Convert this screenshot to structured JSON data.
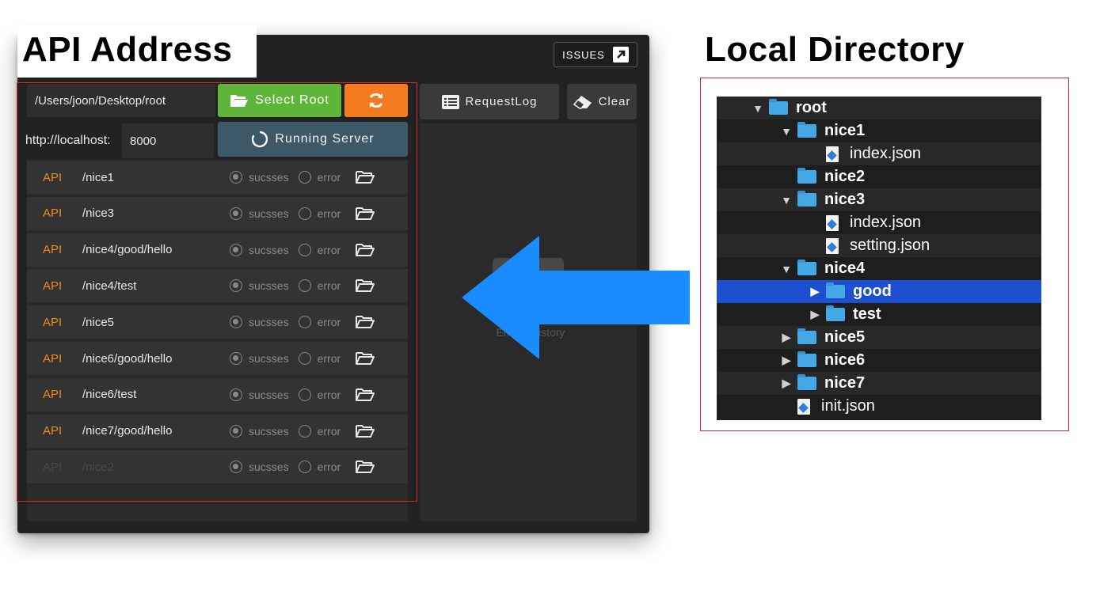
{
  "captions": {
    "left": "API Address",
    "right": "Local Directory"
  },
  "toolbar": {
    "issues_label": "ISSUES",
    "root_path": "/Users/joon/Desktop/root",
    "select_root_label": "Select Root",
    "host_label": "http://localhost:",
    "port": "8000",
    "running_label": "Running Server",
    "request_log_label": "RequestLog",
    "clear_label": "Clear"
  },
  "api_list": {
    "tag": "API",
    "success_label": "sucsses",
    "error_label": "error",
    "rows": [
      {
        "path": "/nice1",
        "disabled": false
      },
      {
        "path": "/nice3",
        "disabled": false
      },
      {
        "path": "/nice4/good/hello",
        "disabled": false
      },
      {
        "path": "/nice4/test",
        "disabled": false
      },
      {
        "path": "/nice5",
        "disabled": false
      },
      {
        "path": "/nice6/good/hello",
        "disabled": false
      },
      {
        "path": "/nice6/test",
        "disabled": false
      },
      {
        "path": "/nice7/good/hello",
        "disabled": false
      },
      {
        "path": "/nice2",
        "disabled": true
      }
    ]
  },
  "history": {
    "empty_text": "Empty History"
  },
  "tree": {
    "rows": [
      {
        "label": "root",
        "type": "folder",
        "depth": 0,
        "expanded": true
      },
      {
        "label": "nice1",
        "type": "folder",
        "depth": 1,
        "expanded": true
      },
      {
        "label": "index.json",
        "type": "file",
        "depth": 2
      },
      {
        "label": "nice2",
        "type": "folder",
        "depth": 1,
        "expanded": null
      },
      {
        "label": "nice3",
        "type": "folder",
        "depth": 1,
        "expanded": true
      },
      {
        "label": "index.json",
        "type": "file",
        "depth": 2
      },
      {
        "label": "setting.json",
        "type": "file",
        "depth": 2
      },
      {
        "label": "nice4",
        "type": "folder",
        "depth": 1,
        "expanded": true
      },
      {
        "label": "good",
        "type": "folder",
        "depth": 2,
        "expanded": false,
        "selected": true
      },
      {
        "label": "test",
        "type": "folder",
        "depth": 2,
        "expanded": false
      },
      {
        "label": "nice5",
        "type": "folder",
        "depth": 1,
        "expanded": false
      },
      {
        "label": "nice6",
        "type": "folder",
        "depth": 1,
        "expanded": false
      },
      {
        "label": "nice7",
        "type": "folder",
        "depth": 1,
        "expanded": false
      },
      {
        "label": "init.json",
        "type": "file",
        "depth": 1
      }
    ]
  },
  "colors": {
    "select_green": "#5db53a",
    "refresh_orange": "#f47b20",
    "api_orange": "#f08a1a",
    "arrow_blue": "#1a8cff",
    "annotation_red": "#d7282f",
    "tree_selected": "#1d4fd1"
  }
}
